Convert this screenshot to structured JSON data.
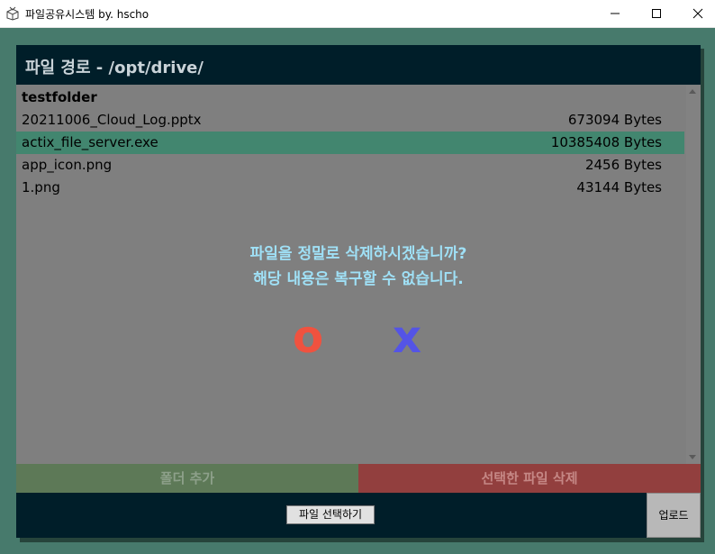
{
  "window": {
    "title": "파일공유시스템 by. hscho",
    "icons": [
      "app-box-icon",
      "minimize-icon",
      "maximize-icon",
      "close-icon"
    ]
  },
  "panel": {
    "title": "파일 경로 - /opt/drive/"
  },
  "files": [
    {
      "name": "testfolder",
      "size": "",
      "type": "folder",
      "selected": false
    },
    {
      "name": "20211006_Cloud_Log.pptx",
      "size": "673094 Bytes",
      "type": "file",
      "selected": false
    },
    {
      "name": "actix_file_server.exe",
      "size": "10385408 Bytes",
      "type": "file",
      "selected": true
    },
    {
      "name": "app_icon.png",
      "size": "2456 Bytes",
      "type": "file",
      "selected": false
    },
    {
      "name": "1.png",
      "size": "43144 Bytes",
      "type": "file",
      "selected": false
    }
  ],
  "dialog": {
    "line1": "파일을 정말로 삭제하시겠습니까?",
    "line2": "해당 내용은 복구할 수 없습니다.",
    "confirm_label": "o",
    "cancel_label": "x"
  },
  "actions": {
    "add_folder": "폴더 추가",
    "delete_selected": "선택한 파일 삭제",
    "choose_file": "파일 선택하기",
    "upload": "업로드"
  },
  "colors": {
    "background": "#477a6c",
    "header": "#001e29",
    "selected_row": "#42866f",
    "confirm": "#f0523f",
    "cancel": "#5454e6",
    "add_folder": "#5d7957",
    "delete": "#923f3e"
  }
}
